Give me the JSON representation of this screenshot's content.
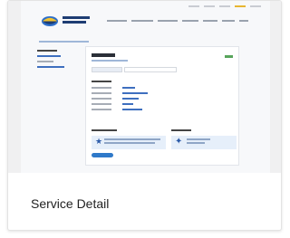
{
  "card": {
    "title": "Service Detail"
  },
  "thumbnail": {
    "description_icon_review": "star-icon",
    "description_icon_vendor": "handshake-icon",
    "brand_color": "#1e3d73",
    "link_color": "#3e6fbf",
    "status_color": "#58a55c",
    "button_color": "#2f79c9",
    "highlight_color": "#e7b531"
  }
}
